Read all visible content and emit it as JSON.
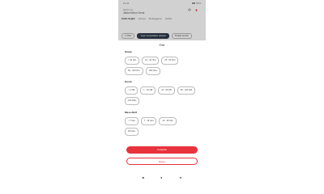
{
  "status_bar": {
    "time": "10:41",
    "battery": "54%"
  },
  "header": {
    "subtitle": "Dikirim ke",
    "title": "Jalan Kebon Jeruk"
  },
  "category_tabs": [
    "Gratis Ongkir",
    "Lainnya",
    "Berlangganan",
    "Terlaris"
  ],
  "filter_bar": {
    "filter_label": "Filter",
    "active_chip": "Juga menyediakan Hotspot",
    "other_chip": "Pindah Sendiri"
  },
  "sheet": {
    "title": "Filter",
    "sections": [
      {
        "title": "Harga",
        "options": [
          "< 10 ribu",
          "10 - 20 ribu",
          "20 - 50 ribu",
          "50 - 100 ribu",
          "100 ribu+"
        ]
      },
      {
        "title": "Kuota",
        "options": [
          "< 1 GB",
          "1 - 10 GB",
          "10 - 50 GB",
          "50 - 100 GB",
          "100 GB+"
        ]
      },
      {
        "title": "Masa Aktif",
        "options": [
          "< 7 hari",
          "7 - 14 hari",
          "14 - 30 hari",
          "30 hari+"
        ]
      }
    ],
    "apply_label": "Terapkan",
    "reset_label": "Reset"
  },
  "navbar": {
    "square": "■",
    "circle": "●",
    "back": "◄"
  }
}
